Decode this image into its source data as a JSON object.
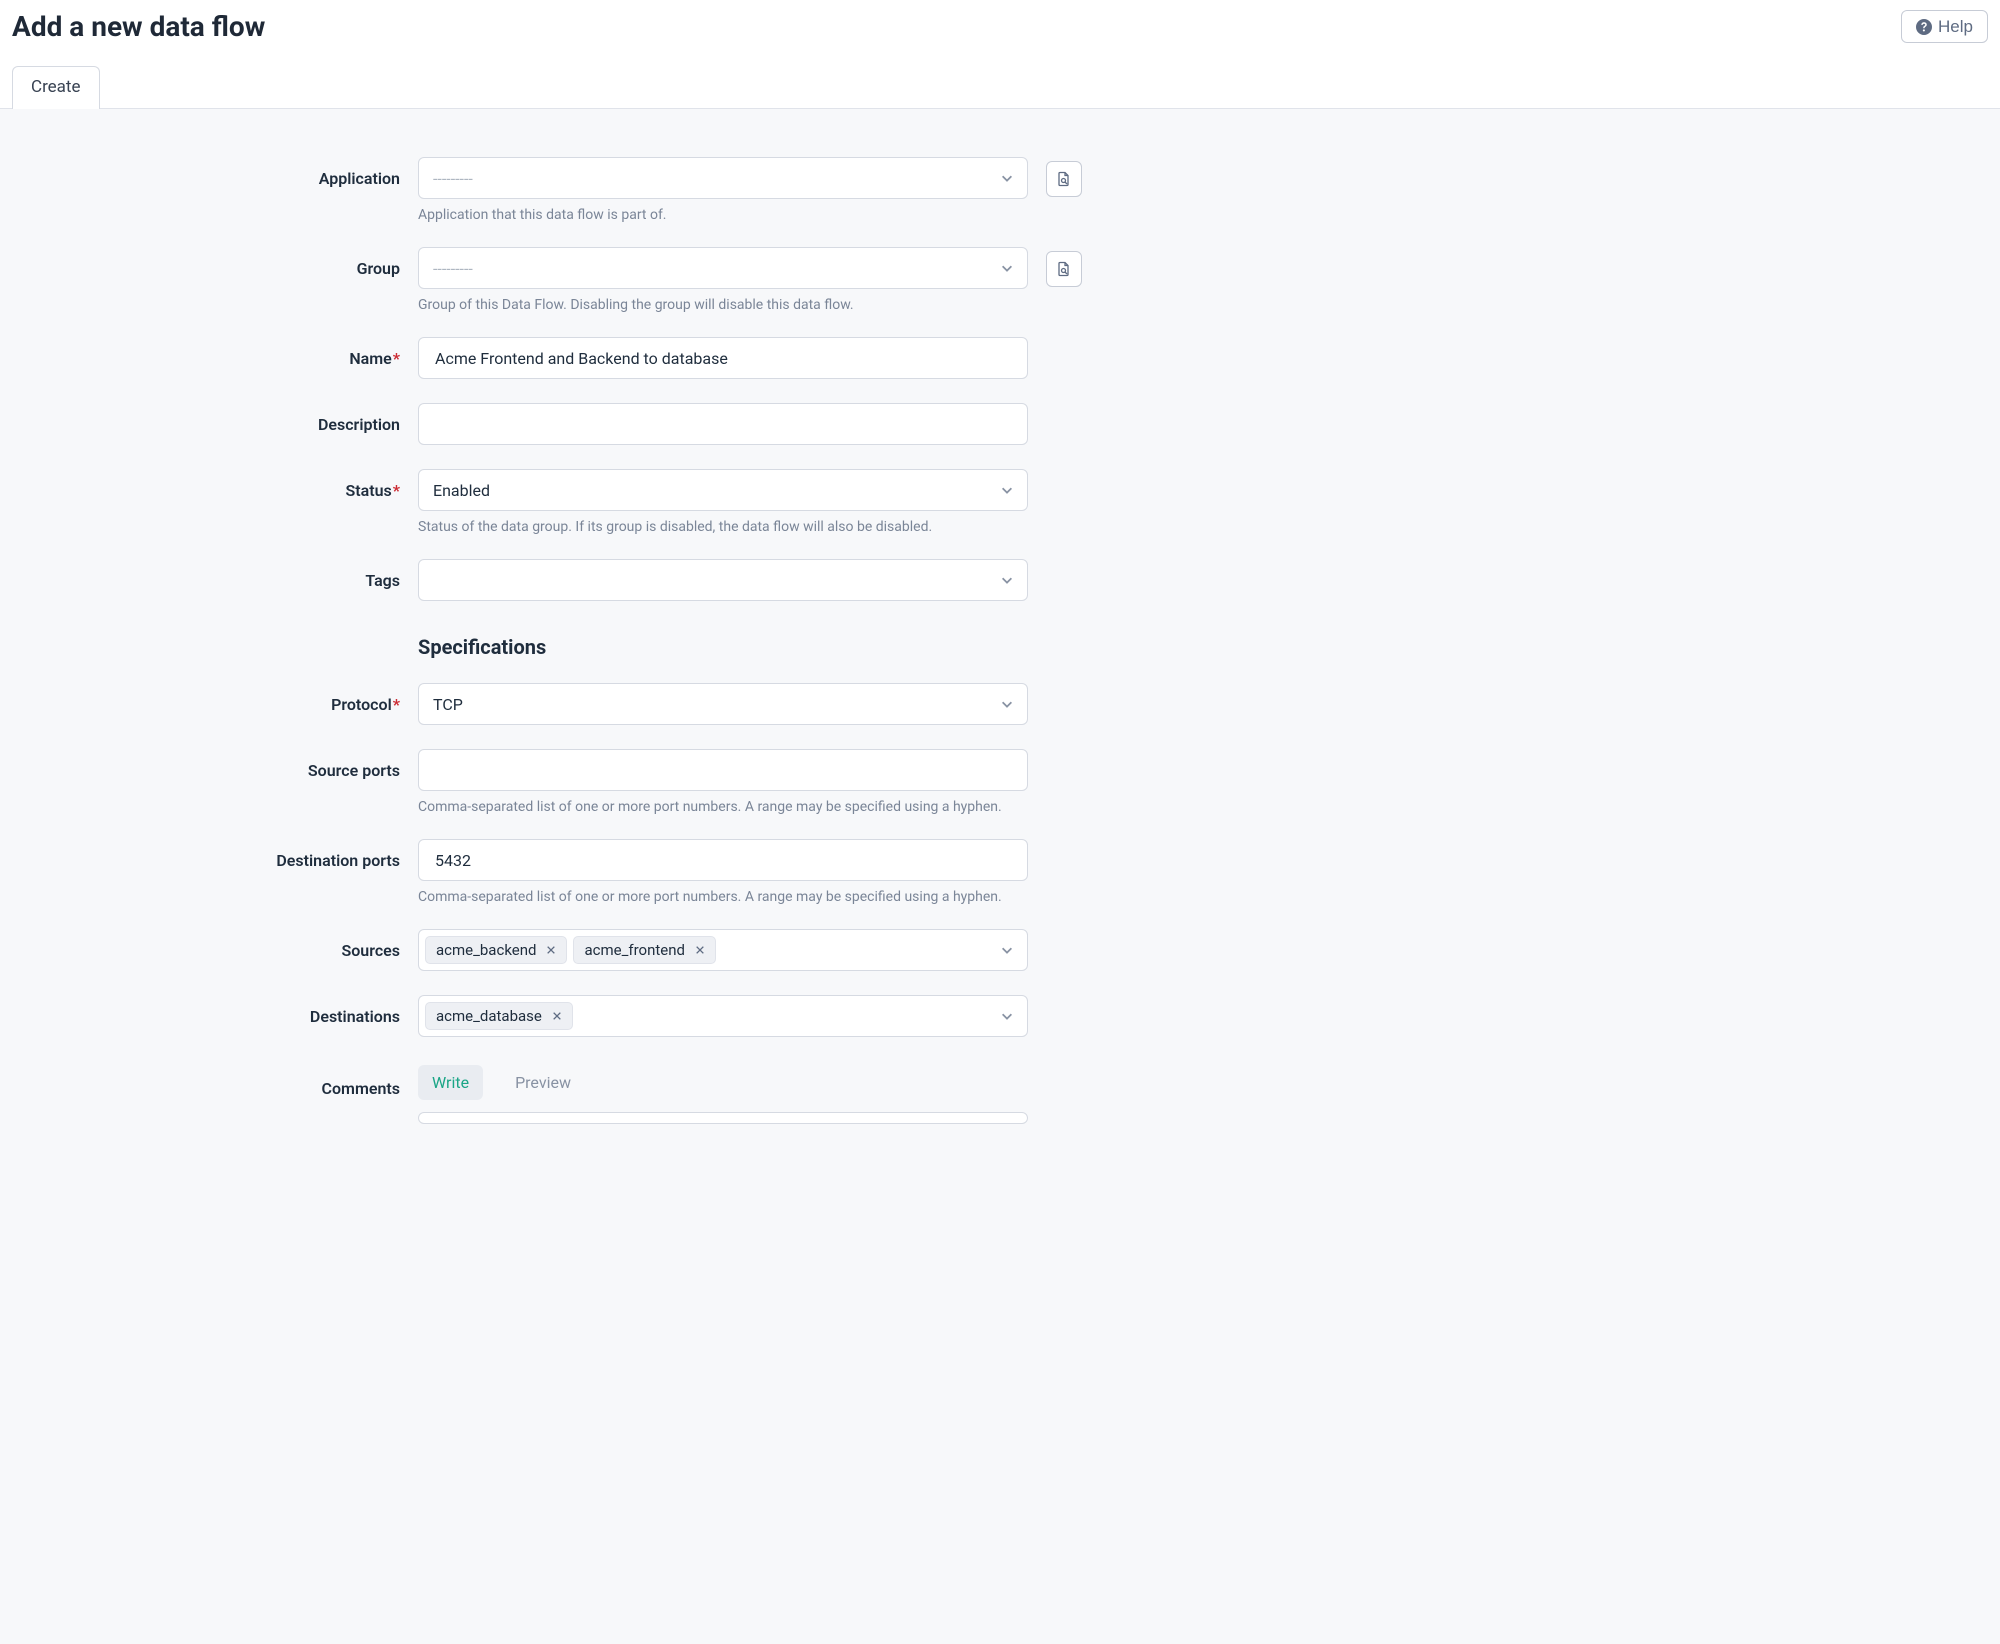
{
  "header": {
    "title": "Add a new data flow",
    "help_label": "Help",
    "tab_create": "Create"
  },
  "placeholder_dashes": "---------",
  "labels": {
    "application": "Application",
    "group": "Group",
    "name": "Name",
    "description": "Description",
    "status": "Status",
    "tags": "Tags",
    "protocol": "Protocol",
    "source_ports": "Source ports",
    "destination_ports": "Destination ports",
    "sources": "Sources",
    "destinations": "Destinations",
    "comments": "Comments"
  },
  "hints": {
    "application": "Application that this data flow is part of.",
    "group": "Group of this Data Flow. Disabling the group will disable this data flow.",
    "status": "Status of the data group. If its group is disabled, the data flow will also be disabled.",
    "ports": "Comma-separated list of one or more port numbers. A range may be specified using a hyphen."
  },
  "values": {
    "name": "Acme Frontend and Backend to database",
    "description": "",
    "status": "Enabled",
    "protocol": "TCP",
    "source_ports": "",
    "destination_ports": "5432"
  },
  "sections": {
    "specifications": "Specifications"
  },
  "sources": [
    "acme_backend",
    "acme_frontend"
  ],
  "destinations": [
    "acme_database"
  ],
  "comments_tabs": {
    "write": "Write",
    "preview": "Preview"
  }
}
